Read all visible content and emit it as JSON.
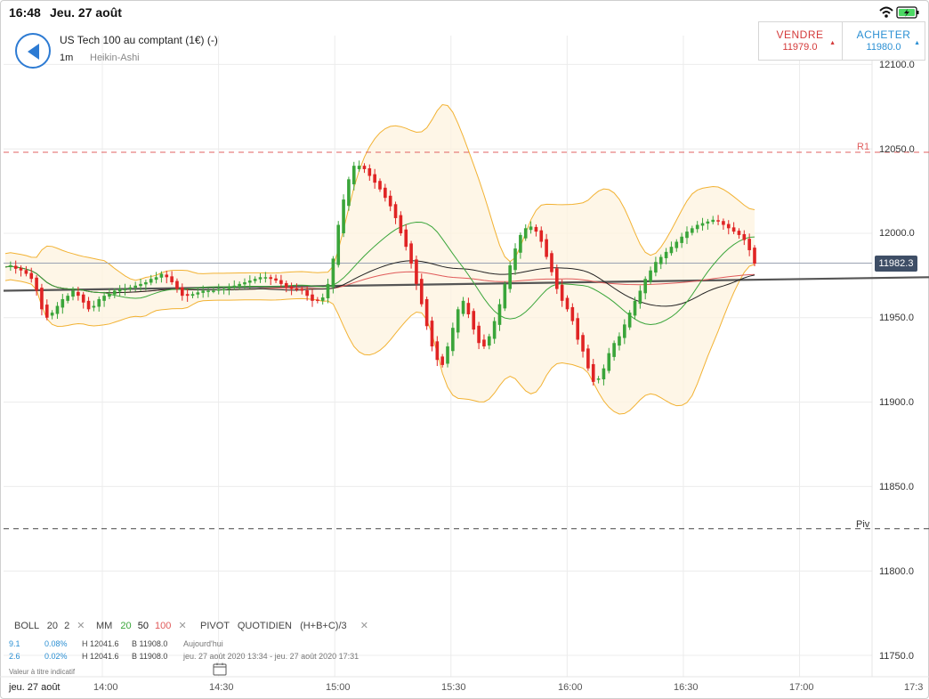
{
  "status_bar": {
    "time": "16:48",
    "date": "Jeu. 27 août",
    "wifi_icon": "wifi-icon",
    "battery_icon": "battery-charging-icon"
  },
  "instrument": {
    "title": "US Tech 100 au comptant (1€) (-)",
    "timeframe": "1m",
    "chart_type": "Heikin-Ashi"
  },
  "trade": {
    "sell_label": "VENDRE",
    "sell_price": "11979.0",
    "buy_label": "ACHETER",
    "buy_price": "11980.0"
  },
  "price_axis": {
    "ticks": [
      "12100.0",
      "12050.0",
      "12000.0",
      "11950.0",
      "11900.0",
      "11850.0",
      "11800.0",
      "11750.0"
    ],
    "current_price": "11982.3"
  },
  "time_axis": {
    "date_label": "jeu. 27 août",
    "ticks": [
      "14:00",
      "14:30",
      "15:00",
      "15:30",
      "16:00",
      "16:30",
      "17:00",
      "17:3"
    ]
  },
  "lines": {
    "r1_label": "R1",
    "piv_label": "Piv"
  },
  "indicators": {
    "boll": {
      "name": "BOLL",
      "p1": "20",
      "p2": "2"
    },
    "mm": {
      "name": "MM",
      "p1": "20",
      "p2": "50",
      "p3": "100"
    },
    "pivot": {
      "name": "PIVOT",
      "p1": "QUOTIDIEN",
      "p2": "(H+B+C)/3"
    }
  },
  "stats": [
    {
      "change": "9.1",
      "pct": "0.08%",
      "high": "H 12041.6",
      "low": "B 11908.0",
      "period": "Aujourd'hui"
    },
    {
      "change": "2.6",
      "pct": "0.02%",
      "high": "H 12041.6",
      "low": "B 11908.0",
      "period": "jeu. 27 août 2020 13:34 - jeu. 27 août 2020 17:31"
    }
  ],
  "footnote": "Valeur à titre indicatif",
  "colors": {
    "up": "#3aa53a",
    "down": "#e02424",
    "boll": "#f2b233",
    "ma20": "#3aa53a",
    "ma50": "#222222",
    "ma100": "#e05a5a",
    "r1": "#e06060",
    "accent": "#2d7bd3"
  },
  "chart_data": {
    "type": "candlestick",
    "style": "Heikin-Ashi",
    "interval": "1m",
    "ylim": [
      11740,
      12115
    ],
    "x_ticks": [
      "14:00",
      "14:30",
      "15:00",
      "15:30",
      "16:00",
      "16:30",
      "17:00"
    ],
    "start_time": "13:34",
    "end_time": "16:48",
    "r1": 12048,
    "pivot": 11825,
    "current_price": 11982.3,
    "close_path": [
      11980,
      11981,
      11979,
      11978,
      11976,
      11973,
      11966,
      11955,
      11950,
      11953,
      11957,
      11961,
      11963,
      11966,
      11963,
      11959,
      11955,
      11957,
      11961,
      11963,
      11964,
      11966,
      11967,
      11967,
      11968,
      11969,
      11970,
      11971,
      11973,
      11974,
      11976,
      11974,
      11971,
      11967,
      11963,
      11963,
      11964,
      11965,
      11966,
      11966,
      11966,
      11967,
      11967,
      11968,
      11969,
      11970,
      11971,
      11972,
      11973,
      11974,
      11974,
      11973,
      11972,
      11970,
      11968,
      11967,
      11967,
      11966,
      11963,
      11960,
      11960,
      11962,
      11970,
      11985,
      12005,
      12020,
      12032,
      12040,
      12040,
      12038,
      12034,
      12030,
      12026,
      12021,
      12016,
      12009,
      12000,
      11992,
      11982,
      11970,
      11958,
      11945,
      11933,
      11925,
      11922,
      11933,
      11944,
      11955,
      11960,
      11952,
      11943,
      11935,
      11933,
      11939,
      11948,
      11958,
      11970,
      11981,
      11991,
      11999,
      12003,
      12004,
      12001,
      11995,
      11986,
      11977,
      11967,
      11960,
      11955,
      11948,
      11937,
      11930,
      11920,
      11912,
      11914,
      11920,
      11929,
      11935,
      11939,
      11946,
      11953,
      11960,
      11966,
      11973,
      11978,
      11983,
      11986,
      11989,
      11992,
      11995,
      11998,
      12001,
      12003,
      12005,
      12006,
      12007,
      12008,
      12007,
      12005,
      12003,
      12001,
      11999,
      11996,
      11990,
      11982
    ]
  }
}
